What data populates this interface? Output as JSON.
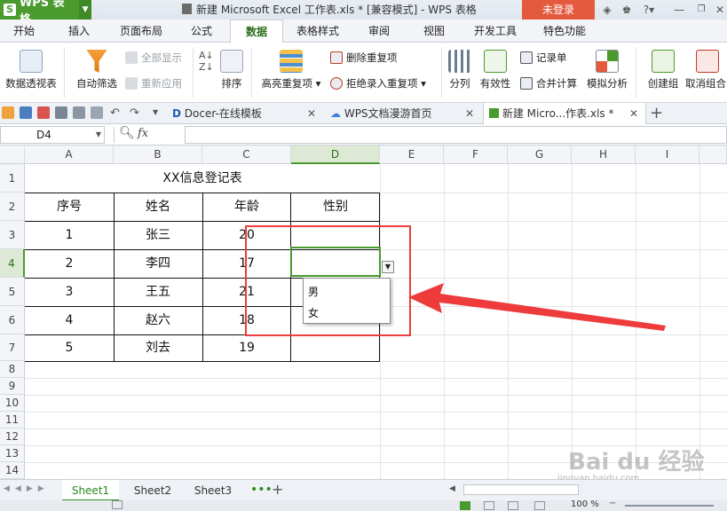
{
  "app": {
    "name": "WPS 表格",
    "logo": "S",
    "doc_title": "新建 Microsoft Excel 工作表.xls * [兼容模式] - WPS 表格",
    "login": "未登录",
    "help": "?"
  },
  "ribbon_tabs": [
    "开始",
    "插入",
    "页面布局",
    "公式",
    "数据",
    "表格样式",
    "审阅",
    "视图",
    "开发工具",
    "特色功能"
  ],
  "active_tab": "数据",
  "ribbon": {
    "pivot": "数据透视表",
    "autofilter": "自动筛选",
    "show_all": "全部显示",
    "reapply": "重新应用",
    "sort": "排序",
    "highlight_dup": "高亮重复项",
    "delete_dup": "删除重复项",
    "reject_dup": "拒绝录入重复项",
    "split": "分列",
    "validity": "有效性",
    "record": "记录单",
    "consolidate": "合并计算",
    "simulate": "模拟分析",
    "group": "创建组",
    "ungroup": "取消组合"
  },
  "doc_tabs": [
    {
      "label": "Docer-在线模板"
    },
    {
      "label": "WPS文档漫游首页"
    },
    {
      "label": "新建 Micro...作表.xls *"
    }
  ],
  "formula_bar": {
    "cell_ref": "D4",
    "fx": "fx"
  },
  "columns": [
    "A",
    "B",
    "C",
    "D",
    "E",
    "F",
    "G",
    "H",
    "I"
  ],
  "rows": [
    "1",
    "2",
    "3",
    "4",
    "5",
    "6",
    "7",
    "8",
    "9",
    "10",
    "11",
    "12",
    "13",
    "14"
  ],
  "table": {
    "title": "XX信息登记表",
    "headers": [
      "序号",
      "姓名",
      "年龄",
      "性别"
    ],
    "rows": [
      [
        "1",
        "张三",
        "20",
        ""
      ],
      [
        "2",
        "李四",
        "17",
        ""
      ],
      [
        "3",
        "王五",
        "21",
        ""
      ],
      [
        "4",
        "赵六",
        "18",
        ""
      ],
      [
        "5",
        "刘去",
        "19",
        ""
      ]
    ]
  },
  "dropdown_options": [
    "男",
    "女"
  ],
  "sheets": [
    "Sheet1",
    "Sheet2",
    "Sheet3"
  ],
  "active_sheet": "Sheet1",
  "zoom": "100 %",
  "watermark": {
    "brand": "Bai du 经验",
    "url": "jingyan.baidu.com"
  },
  "colors": {
    "accent": "#4a9a2e",
    "annotation": "#ee3b3b",
    "login": "#e45a3d"
  }
}
